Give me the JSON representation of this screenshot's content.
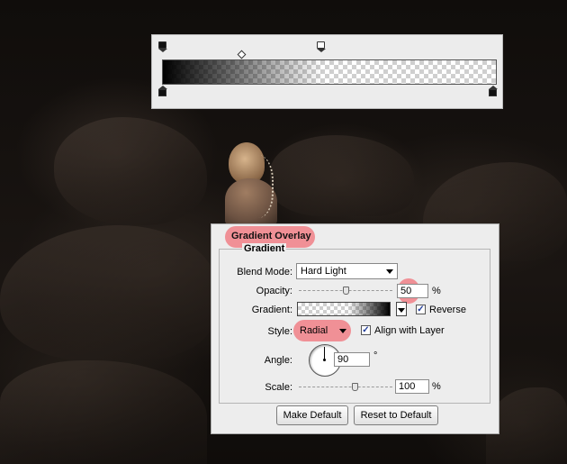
{
  "gradient_editor": {
    "stops": [
      "opacity-stop-black",
      "opacity-stop-white",
      "color-stop-black-left",
      "color-stop-black-right"
    ]
  },
  "dialog": {
    "section_title": "Gradient Overlay",
    "group_title": "Gradient",
    "blend_mode": {
      "label": "Blend Mode:",
      "value": "Hard Light"
    },
    "opacity": {
      "label": "Opacity:",
      "value": "50",
      "unit": "%",
      "slider_level": 0.5
    },
    "gradient": {
      "label": "Gradient:",
      "reverse_label": "Reverse",
      "reverse_checked": true
    },
    "style": {
      "label": "Style:",
      "value": "Radial",
      "align_label": "Align with Layer",
      "align_checked": true
    },
    "angle": {
      "label": "Angle:",
      "value": "90",
      "unit": "°"
    },
    "scale": {
      "label": "Scale:",
      "value": "100",
      "unit": "%"
    },
    "buttons": {
      "make_default": "Make Default",
      "reset_default": "Reset to Default"
    }
  },
  "colors": {
    "highlight": "#f07f86",
    "check": "#213c9a"
  }
}
